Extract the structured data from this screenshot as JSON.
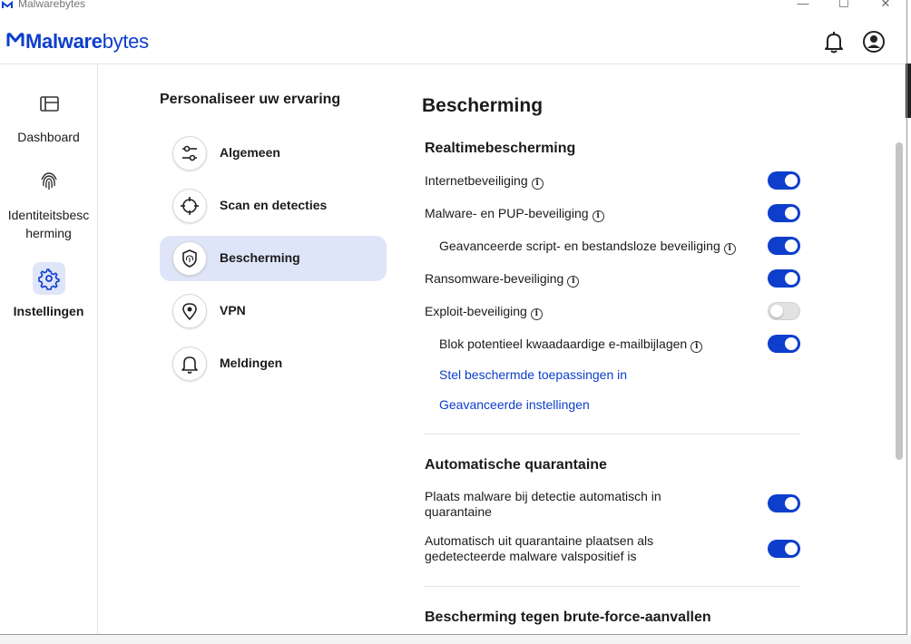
{
  "window": {
    "title": "Malwarebytes",
    "minimize": "—",
    "maximize": "☐",
    "close": "✕"
  },
  "header": {
    "logo_bold": "Malware",
    "logo_light": "bytes"
  },
  "sidebar": {
    "items": [
      {
        "label": "Dashboard",
        "icon": "dashboard-icon"
      },
      {
        "label": "Identiteitsbesc herming",
        "icon": "fingerprint-icon"
      },
      {
        "label": "Instellingen",
        "icon": "gear-icon",
        "active": true
      }
    ]
  },
  "menu": {
    "title": "Personaliseer uw ervaring",
    "items": [
      {
        "label": "Algemeen",
        "icon": "sliders-icon"
      },
      {
        "label": "Scan en detecties",
        "icon": "crosshair-icon"
      },
      {
        "label": "Bescherming",
        "icon": "shield-icon",
        "active": true
      },
      {
        "label": "VPN",
        "icon": "location-pin-icon"
      },
      {
        "label": "Meldingen",
        "icon": "bell-icon"
      }
    ]
  },
  "content": {
    "title": "Bescherming",
    "realtime": {
      "title": "Realtimebescherming",
      "rows": [
        {
          "label": "Internetbeveiliging",
          "on": true
        },
        {
          "label": "Malware- en PUP-beveiliging",
          "on": true
        },
        {
          "label": "Geavanceerde script- en bestandsloze beveiliging",
          "on": true
        },
        {
          "label": "Ransomware-beveiliging",
          "on": true
        },
        {
          "label": "Exploit-beveiliging",
          "on": false
        },
        {
          "label": "Blok potentieel kwaadaardige e-mailbijlagen",
          "on": true
        }
      ],
      "link_protected_apps": "Stel beschermde toepassingen in",
      "link_advanced": "Geavanceerde instellingen"
    },
    "quarantine": {
      "title": "Automatische quarantaine",
      "row1_line1": "Plaats malware bij detectie automatisch in",
      "row1_line2": "quarantaine",
      "row2_line1": "Automatisch uit quarantaine plaatsen als",
      "row2_line2": "gedetecteerde malware valspositief is"
    },
    "bruteforce": {
      "title": "Bescherming tegen brute-force-aanvallen"
    },
    "info_glyph": "i"
  },
  "colors": {
    "accent": "#0d3ecc",
    "active_bg": "#dfe5f8",
    "toggle_off": "#e2e2e2"
  }
}
